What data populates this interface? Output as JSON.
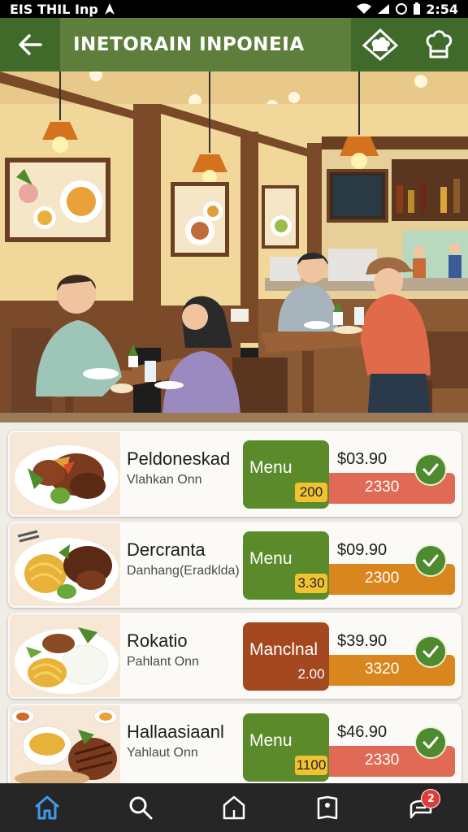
{
  "status_bar": {
    "left_text": "EIS THIL Inp",
    "time": "2:54"
  },
  "app_bar": {
    "title": "INETORAIN INPONEIA"
  },
  "icons": {
    "back": "arrow-left-icon",
    "action1": "chef-hat-badge-icon",
    "action2": "chef-hat-icon",
    "nav": [
      "home-icon",
      "search-icon",
      "house-icon",
      "book-icon",
      "chat-icon"
    ]
  },
  "menu_items": [
    {
      "name": "Peldoneskad",
      "subtitle": "Vlahkan Onn",
      "button_label": "Menu",
      "qty": "200",
      "price": "$03.90",
      "bar_value": "2330"
    },
    {
      "name": "Dercranta",
      "subtitle": "Danhang(Eradklda)",
      "button_label": "Menu",
      "qty": "3.30",
      "price": "$09.90",
      "bar_value": "2300"
    },
    {
      "name": "Rokatio",
      "subtitle": "Pahlant Onn",
      "button_label": "Manclnal",
      "qty": "2.00",
      "price": "$39.90",
      "bar_value": "3320"
    },
    {
      "name": "Hallaasiaanl",
      "subtitle": "Yahlaut Onn",
      "button_label": "Menu",
      "qty": "1100",
      "price": "$46.90",
      "bar_value": "2330"
    }
  ],
  "nav": {
    "badge_count": "2"
  },
  "colors": {
    "primary_green": "#5e7f3c",
    "dark_green": "#3f6a2a",
    "button_green": "#5a8a2a",
    "button_brown": "#a4481f",
    "bar_red": "#e06a55",
    "bar_orange": "#d9861e",
    "qty_yellow": "#f2c233",
    "badge_red": "#e23b35"
  }
}
